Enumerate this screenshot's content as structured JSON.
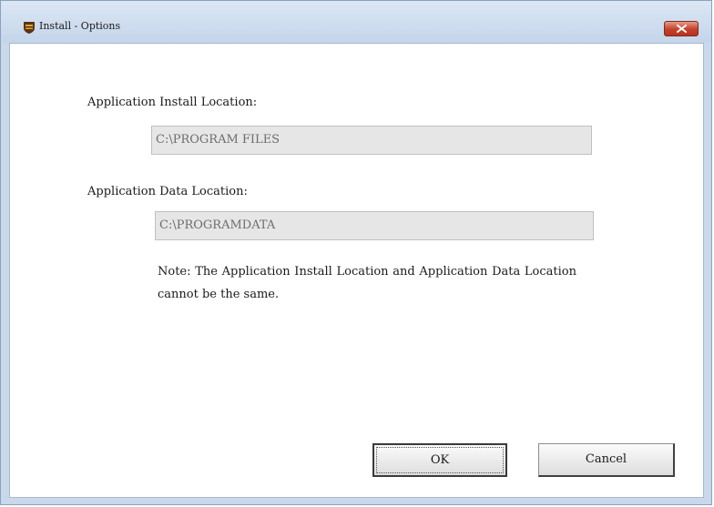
{
  "window": {
    "title": "Install - Options",
    "icon": "ups-shield-icon",
    "close_icon": "close-icon"
  },
  "install_location": {
    "label": "Application Install Location:",
    "value": "C:\\PROGRAM FILES"
  },
  "data_location": {
    "label": "Application Data Location:",
    "value": "C:\\PROGRAMDATA"
  },
  "note": "Note: The Application Install Location and Application Data Location cannot be the same.",
  "buttons": {
    "ok_label": "OK",
    "cancel_label": "Cancel"
  },
  "colors": {
    "title_bar": "#c4d5ea",
    "close_button": "#c5402b",
    "field_background": "#e6e6e6"
  }
}
